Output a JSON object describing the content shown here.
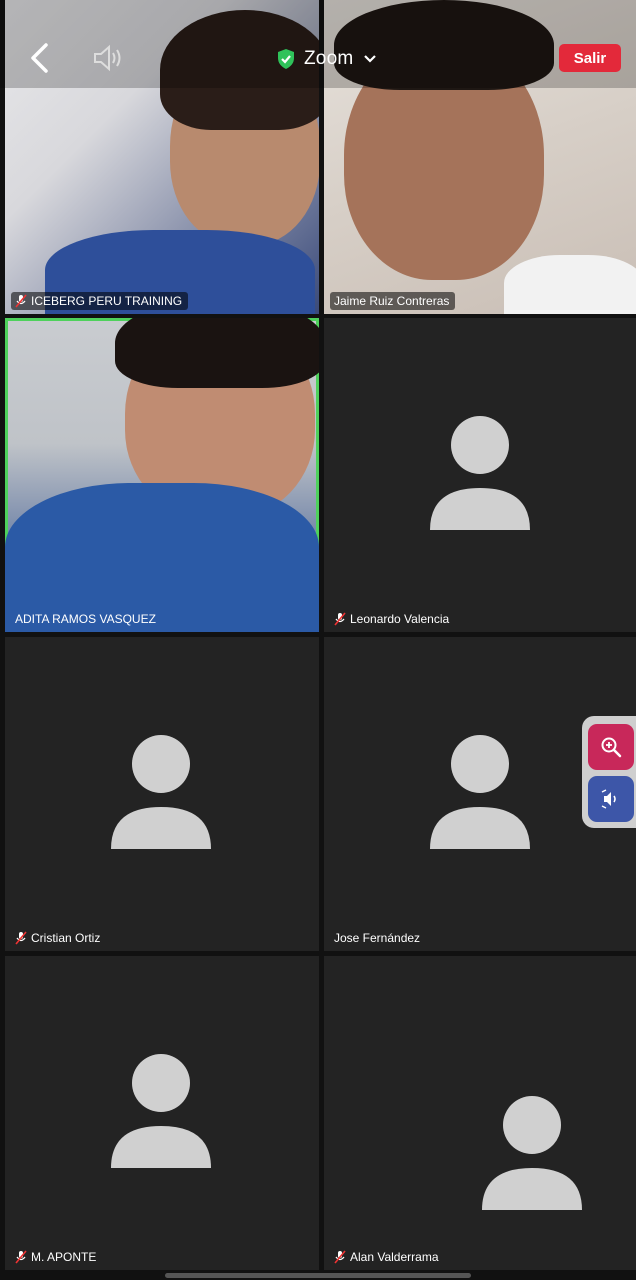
{
  "header": {
    "title": "Zoom",
    "leave_label": "Salir",
    "icons": [
      "back-icon",
      "speaker-icon",
      "shield-check-icon",
      "chevron-down-icon"
    ]
  },
  "participants": [
    {
      "name": "ICEBERG PERU TRAINING",
      "muted": true,
      "video": true
    },
    {
      "name": "Jaime Ruiz Contreras",
      "muted": false,
      "video": true
    },
    {
      "name": "ADITA RAMOS VASQUEZ",
      "muted": false,
      "video": true,
      "active_speaker": true
    },
    {
      "name": "Leonardo Valencia",
      "muted": true,
      "video": false
    },
    {
      "name": "Cristian Ortiz",
      "muted": true,
      "video": false
    },
    {
      "name": "Jose Fernández",
      "muted": false,
      "video": false
    },
    {
      "name": "M. APONTE",
      "muted": true,
      "video": false
    },
    {
      "name": "Alan Valderrama",
      "muted": true,
      "video": false
    }
  ],
  "floating_controls": [
    "zoom-in-icon",
    "audio-icon"
  ],
  "colors": {
    "active_border": "#4ed15c",
    "leave": "#e3293a",
    "tile_bg": "#232323",
    "avatar": "#d0d0d0"
  }
}
